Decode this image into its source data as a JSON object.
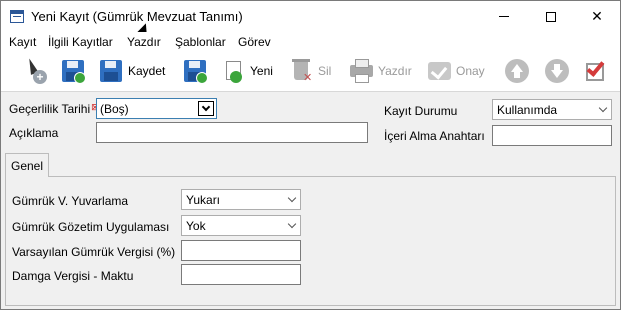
{
  "window": {
    "title": "Yeni Kayıt (Gümrük Mevzuat Tanımı)"
  },
  "menu": [
    "Kayıt",
    "İlgili Kayıtlar",
    "Yazdır",
    "Şablonlar",
    "Görev"
  ],
  "toolbar": {
    "save_label": "Kaydet",
    "new_label": "Yeni",
    "delete_label": "Sil",
    "print_label": "Yazdır",
    "approve_label": "Onay"
  },
  "form": {
    "validity_date": {
      "label": "Geçerlilik Tarihi",
      "required_mark": "⊠",
      "value": "(Boş)"
    },
    "description": {
      "label": "Açıklama",
      "value": ""
    },
    "record_status": {
      "label": "Kayıt Durumu",
      "value": "Kullanımda"
    },
    "import_key": {
      "label": "İçeri Alma Anahtarı",
      "value": ""
    }
  },
  "tabs": [
    {
      "label": "Genel"
    }
  ],
  "general": {
    "rounding": {
      "label": "Gümrük V. Yuvarlama",
      "value": "Yukarı"
    },
    "supervision": {
      "label": "Gümrük Gözetim Uygulaması",
      "value": "Yok"
    },
    "default_duty": {
      "label": "Varsayılan Gümrük Vergisi (%)",
      "value": ""
    },
    "stamp_duty": {
      "label": "Damga Vergisi - Maktu",
      "value": ""
    }
  }
}
